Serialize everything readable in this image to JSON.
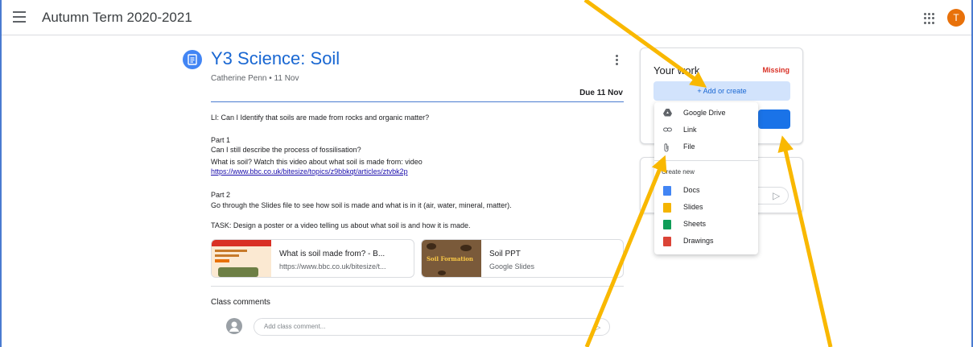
{
  "topbar": {
    "title": "Autumn Term 2020-2021",
    "avatar_letter": "T"
  },
  "assignment": {
    "title": "Y3 Science: Soil",
    "meta": "Catherine Penn • 11 Nov",
    "due": "Due 11 Nov",
    "lines": {
      "li": "LI: Can I Identify that soils are made from rocks and organic matter?",
      "part1_h": "Part 1",
      "part1_a": "Can I still describe the process of fossilisation?",
      "part1_b": "What is soil?  Watch this video about what soil is made from: video",
      "part1_link": "https://www.bbc.co.uk/bitesize/topics/z9bbkqt/articles/ztvbk2p",
      "part2_h": "Part 2",
      "part2_a": "Go through the Slides file to see how soil is made and what is in it (air, water, mineral, matter).",
      "task": "TASK:  Design a poster or a video telling us about what soil is and how it is made."
    },
    "attachments": [
      {
        "title": "What is soil made from? - B...",
        "subtitle": "https://www.bbc.co.uk/bitesize/t..."
      },
      {
        "title": "Soil PPT",
        "subtitle": "Google Slides",
        "thumb_text": "Soil Formation"
      }
    ]
  },
  "class_comments": {
    "label": "Class comments",
    "placeholder": "Add class comment..."
  },
  "your_work": {
    "title": "Your work",
    "status": "Missing",
    "add_label": "+ Add or create"
  },
  "menu": {
    "items": [
      "Google Drive",
      "Link",
      "File"
    ],
    "create_new_label": "Create new",
    "create_items": [
      "Docs",
      "Slides",
      "Sheets",
      "Drawings"
    ]
  },
  "colors": {
    "accent": "#1967d2",
    "missing": "#d93025",
    "avatar": "#e8710a",
    "arrow": "#f9b800"
  }
}
